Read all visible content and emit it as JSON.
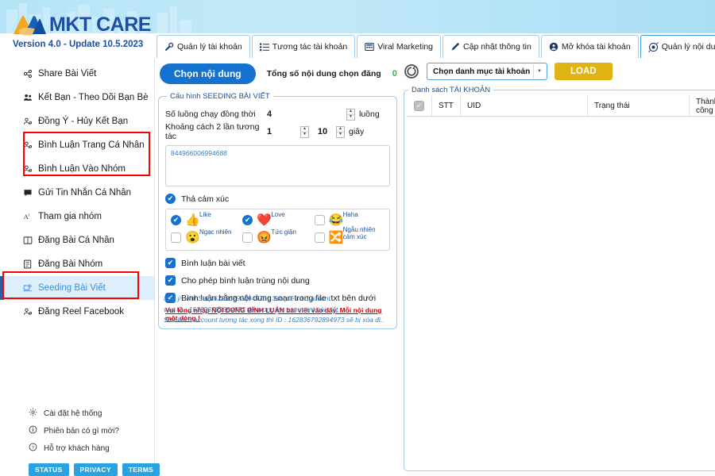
{
  "app": {
    "logo_text": "MKT CARE",
    "version": "Version 4.0 - Update 10.5.2023"
  },
  "tabs": [
    {
      "label": "Quản lý tài khoản",
      "icon": "wrench-icon",
      "active": false
    },
    {
      "label": "Tương tác tài khoản",
      "icon": "list-icon",
      "active": false
    },
    {
      "label": "Viral Marketing",
      "icon": "grid-icon",
      "active": false
    },
    {
      "label": "Cập nhật thông tin",
      "icon": "pencil-icon",
      "active": false
    },
    {
      "label": "Mở khóa tài khoản",
      "icon": "lock-icon",
      "active": false
    },
    {
      "label": "Quản lý nội dung",
      "icon": "content-icon",
      "active": true
    }
  ],
  "sidebar": {
    "items": [
      {
        "label": "Share Bài Viết",
        "icon": "share-icon",
        "selected": false
      },
      {
        "label": "Kết Bạn - Theo Dõi Bạn Bè",
        "icon": "friends-icon",
        "selected": false
      },
      {
        "label": "Đồng Ý - Hủy Kết Bạn",
        "icon": "person-icon",
        "selected": false
      },
      {
        "label": "Bình Luận Trang Cá Nhân",
        "icon": "person-icon",
        "selected": false
      },
      {
        "label": "Bình Luận Vào Nhóm",
        "icon": "person-icon",
        "selected": false
      },
      {
        "label": "Gửi Tin Nhắn Cá Nhân",
        "icon": "message-icon",
        "selected": false
      },
      {
        "label": "Tham gia nhóm",
        "icon": "text-icon",
        "selected": false
      },
      {
        "label": "Đăng Bài Cá Nhân",
        "icon": "book-icon",
        "selected": false
      },
      {
        "label": "Đăng Bài Nhóm",
        "icon": "page-icon",
        "selected": false
      },
      {
        "label": "Seeding Bài Viết",
        "icon": "seeding-icon",
        "selected": true
      },
      {
        "label": "Đăng Reel Facebook",
        "icon": "person-icon",
        "selected": false
      }
    ],
    "system": [
      {
        "label": "Cài đặt hệ thống",
        "icon": "gear-icon"
      },
      {
        "label": "Phiên bản có gì mới?",
        "icon": "info-icon"
      },
      {
        "label": "Hỗ trợ khách hàng",
        "icon": "help-icon"
      }
    ],
    "badges": [
      "STATUS",
      "PRIVACY",
      "TERMS"
    ]
  },
  "center": {
    "choose_content_button": "Chọn nội dung",
    "total_label": "Tổng số nội dung chọn đăng",
    "total_count": "0",
    "panel_legend": "Cấu hình SEEDING BÀI VIẾT",
    "threads_label": "Số luồng chạy đồng thời",
    "threads_value": "4",
    "threads_unit": "luồng",
    "interval_label": "Khoảng cách 2 lần tương tác",
    "interval_min": "1",
    "interval_max": "10",
    "interval_unit": "giây",
    "post_id": "844966006994688",
    "reactions_toggle_label": "Thả cảm xúc",
    "reactions_toggle_checked": true,
    "reactions": [
      {
        "label": "Like",
        "emoji": "👍",
        "checked": true
      },
      {
        "label": "Love",
        "emoji": "❤️",
        "checked": true
      },
      {
        "label": "Haha",
        "emoji": "😂",
        "checked": false
      },
      {
        "label": "Ngạc nhiên",
        "emoji": "😮",
        "checked": false
      },
      {
        "label": "Tức giận",
        "emoji": "😡",
        "checked": false
      },
      {
        "label": "Ngẫu nhiên cảm xúc",
        "emoji": "🔀",
        "checked": false
      }
    ],
    "options": [
      {
        "label": "Bình luận bài viết",
        "checked": true
      },
      {
        "label": "Cho phép bình luận trùng nội dung",
        "checked": true
      },
      {
        "label": "Bình luận bằng nội dung soạn trong file .txt bên dưới",
        "checked": true
      }
    ],
    "hint_link": "Vui lòng nhập NỘI DUNG BÌNH LUẬN bài viết vào đây. Mỗi nội dung một dòng !",
    "note_lines": [
      "Lưu ý : Khi Set 162836792894973 | 3 thì sẽ có 3 accont",
      "vào ID : 162836792894973 để tương tác comment bài viết.",
      "Sau khi 3 account tương tác xong thì ID : 162836792894973 sẽ bị xóa đi.."
    ]
  },
  "right": {
    "refresh_icon": "refresh-icon",
    "category_select_value": "Chọn danh mục tài khoản",
    "load_button": "LOAD",
    "table_legend": "Danh sách TÀI KHOẢN",
    "columns": [
      "STT",
      "UID",
      "Trạng thái",
      "Thành công"
    ],
    "rows": []
  },
  "colors": {
    "accent_blue": "#1672cf",
    "load_gold": "#dfb414",
    "selected_bg": "#ddeefc",
    "annotation_red": "#ff0000",
    "count_green": "#3bb54a"
  }
}
